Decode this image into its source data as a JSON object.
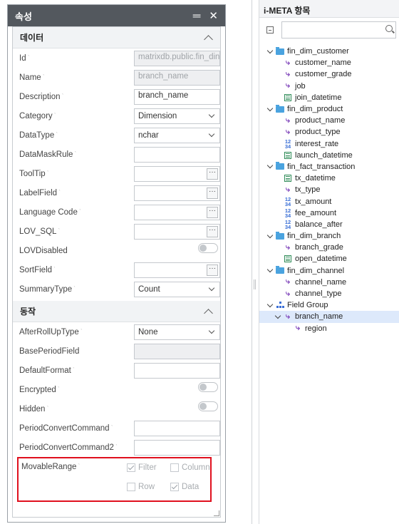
{
  "properties_panel": {
    "title": "속성",
    "sections": {
      "data": {
        "label": "데이터",
        "rows": {
          "id": {
            "label": "Id",
            "value": "matrixdb.public.fin_din"
          },
          "name": {
            "label": "Name",
            "value": "branch_name"
          },
          "description": {
            "label": "Description",
            "value": "branch_name"
          },
          "category": {
            "label": "Category",
            "value": "Dimension"
          },
          "datatype": {
            "label": "DataType",
            "value": "nchar"
          },
          "datamaskrule": {
            "label": "DataMaskRule",
            "value": ""
          },
          "tooltip": {
            "label": "ToolTip",
            "value": ""
          },
          "labelfield": {
            "label": "LabelField",
            "value": ""
          },
          "languagecode": {
            "label": "Language Code",
            "value": ""
          },
          "lov_sql": {
            "label": "LOV_SQL",
            "value": ""
          },
          "lovdisabled": {
            "label": "LOVDisabled"
          },
          "sortfield": {
            "label": "SortField",
            "value": ""
          },
          "summarytype": {
            "label": "SummaryType",
            "value": "Count"
          }
        }
      },
      "behavior": {
        "label": "동작",
        "rows": {
          "afterrollup": {
            "label": "AfterRollUpType",
            "value": "None"
          },
          "baseperiod": {
            "label": "BasePeriodField",
            "value": ""
          },
          "defaultformat": {
            "label": "DefaultFormat",
            "value": ""
          },
          "encrypted": {
            "label": "Encrypted"
          },
          "hidden": {
            "label": "Hidden"
          },
          "periodconvert": {
            "label": "PeriodConvertCommand",
            "value": ""
          },
          "periodconvert2": {
            "label": "PeriodConvertCommand2",
            "value": ""
          },
          "movablerange": {
            "label": "MovableRange",
            "options": {
              "filter": {
                "label": "Filter",
                "checked": true
              },
              "column": {
                "label": "Column",
                "checked": false
              },
              "row": {
                "label": "Row",
                "checked": false
              },
              "data": {
                "label": "Data",
                "checked": true
              }
            }
          }
        }
      }
    }
  },
  "meta_panel": {
    "title": "i-META 항목",
    "search_placeholder": "",
    "tree": [
      {
        "label": "fin_dim_customer",
        "icon": "folder-icon",
        "level": 0,
        "expanded": true
      },
      {
        "label": "customer_name",
        "icon": "dimension-icon",
        "level": 1
      },
      {
        "label": "customer_grade",
        "icon": "dimension-icon",
        "level": 1
      },
      {
        "label": "job",
        "icon": "dimension-icon",
        "level": 1
      },
      {
        "label": "join_datetime",
        "icon": "date-icon",
        "level": 1
      },
      {
        "label": "fin_dim_product",
        "icon": "folder-icon",
        "level": 0,
        "expanded": true
      },
      {
        "label": "product_name",
        "icon": "dimension-icon",
        "level": 1
      },
      {
        "label": "product_type",
        "icon": "dimension-icon",
        "level": 1
      },
      {
        "label": "interest_rate",
        "icon": "number-icon",
        "level": 1
      },
      {
        "label": "launch_datetime",
        "icon": "date-icon",
        "level": 1
      },
      {
        "label": "fin_fact_transaction",
        "icon": "folder-icon",
        "level": 0,
        "expanded": true
      },
      {
        "label": "tx_datetime",
        "icon": "date-icon",
        "level": 1
      },
      {
        "label": "tx_type",
        "icon": "dimension-icon",
        "level": 1
      },
      {
        "label": "tx_amount",
        "icon": "number-icon",
        "level": 1
      },
      {
        "label": "fee_amount",
        "icon": "number-icon",
        "level": 1
      },
      {
        "label": "balance_after",
        "icon": "number-icon",
        "level": 1
      },
      {
        "label": "fin_dim_branch",
        "icon": "folder-icon",
        "level": 0,
        "expanded": true
      },
      {
        "label": "branch_grade",
        "icon": "dimension-icon",
        "level": 1
      },
      {
        "label": "open_datetime",
        "icon": "date-icon",
        "level": 1
      },
      {
        "label": "fin_dim_channel",
        "icon": "folder-icon",
        "level": 0,
        "expanded": true
      },
      {
        "label": "channel_name",
        "icon": "dimension-icon",
        "level": 1
      },
      {
        "label": "channel_type",
        "icon": "dimension-icon",
        "level": 1
      },
      {
        "label": "Field Group",
        "icon": "field-group-icon",
        "level": 0,
        "expanded": true
      },
      {
        "label": "branch_name",
        "icon": "dimension-icon",
        "level": 1,
        "expanded": true,
        "selected": true
      },
      {
        "label": "region",
        "icon": "dimension-icon",
        "level": 2
      }
    ]
  },
  "colors": {
    "header_bg": "#53585e",
    "highlight_border": "#e0101e",
    "selected_row": "#dde9fb",
    "folder": "#4aa3df"
  }
}
